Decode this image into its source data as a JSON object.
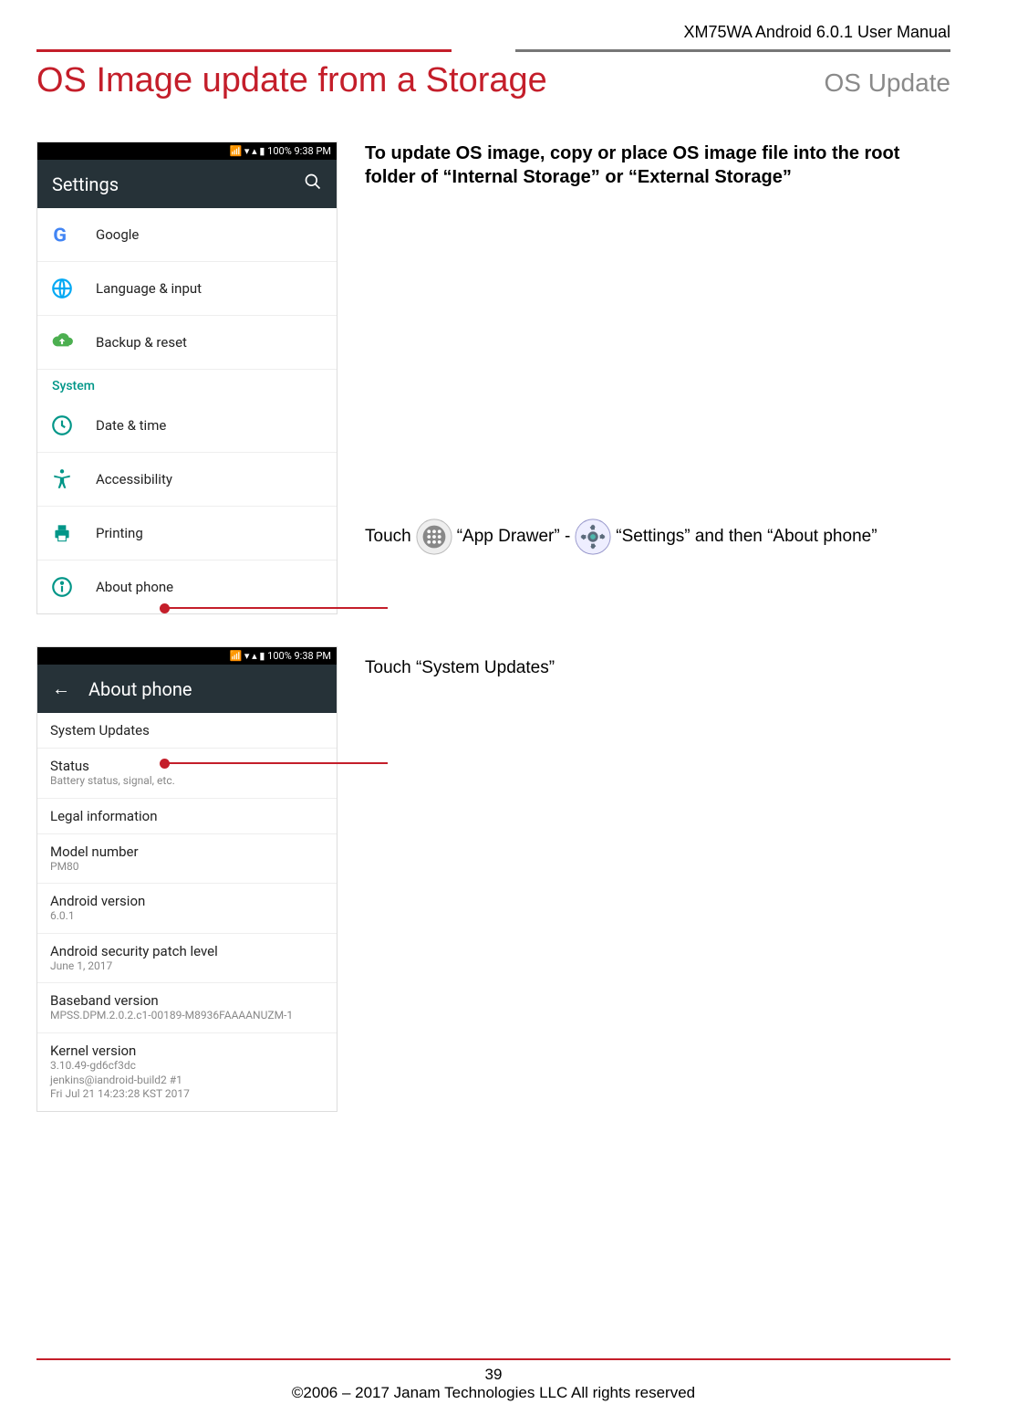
{
  "header": {
    "doc_title": "XM75WA Android 6.0.1 User Manual"
  },
  "titles": {
    "left": "OS Image update from a Storage",
    "right": "OS Update"
  },
  "intro": "To update OS image, copy or place OS image file into the root folder of “Internal Storage” or “External Storage”",
  "shot1": {
    "status": "100%  9:38 PM",
    "appbar_title": "Settings",
    "rows": [
      {
        "icon": "google-g-icon",
        "label": "Google"
      },
      {
        "icon": "globe-icon",
        "label": "Language & input"
      },
      {
        "icon": "cloud-up-icon",
        "label": "Backup & reset"
      }
    ],
    "section": "System",
    "rows2": [
      {
        "icon": "clock-icon",
        "label": "Date & time"
      },
      {
        "icon": "accessibility-icon",
        "label": "Accessibility"
      },
      {
        "icon": "printer-icon",
        "label": "Printing"
      },
      {
        "icon": "info-icon",
        "label": "About phone"
      }
    ]
  },
  "shot2": {
    "status": "100%  9:38 PM",
    "appbar_title": "About phone",
    "rows": [
      {
        "primary": "System Updates",
        "secondary": ""
      },
      {
        "primary": "Status",
        "secondary": "Battery status, signal, etc."
      },
      {
        "primary": "Legal information",
        "secondary": ""
      },
      {
        "primary": "Model number",
        "secondary": "PM80"
      },
      {
        "primary": "Android version",
        "secondary": "6.0.1"
      },
      {
        "primary": "Android security patch level",
        "secondary": "June 1, 2017"
      },
      {
        "primary": "Baseband version",
        "secondary": "MPSS.DPM.2.0.2.c1-00189-M8936FAAAANUZM-1"
      },
      {
        "primary": "Kernel version",
        "secondary": "3.10.49-gd6cf3dc\njenkins@iandroid-build2 #1\nFri Jul 21 14:23:28 KST 2017"
      }
    ]
  },
  "instr1": {
    "p1": "Touch",
    "p2": "“App Drawer” -",
    "p3": "“Settings” and then “About phone”"
  },
  "instr2": "Touch “System Updates”",
  "footer": {
    "page": "39",
    "copyright": "©2006 – 2017 Janam Technologies LLC All rights reserved"
  }
}
